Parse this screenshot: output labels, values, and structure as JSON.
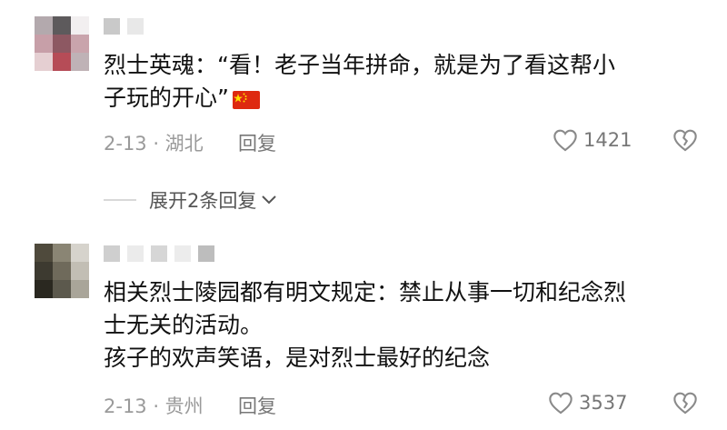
{
  "comments": [
    {
      "text_lines": [
        "烈士英魂：“看！老子当年拼命，就是为了看这帮小",
        "子玩的开心”"
      ],
      "flag_icon": "china-flag-icon",
      "date_location": "2-13 · 湖北",
      "reply_label": "回复",
      "likes": "1421"
    },
    {
      "text_lines": [
        "相关烈士陵园都有明文规定：禁止从事一切和纪念烈",
        "士无关的活动。",
        "孩子的欢声笑语，是对烈士最好的纪念"
      ],
      "date_location": "2-13 · 贵州",
      "reply_label": "回复",
      "likes": "3537"
    }
  ],
  "expand_replies_label": "展开2条回复",
  "icons": {
    "like": "heart-icon",
    "dislike": "broken-heart-icon",
    "expand": "chevron-down-icon"
  },
  "colors": {
    "text": "#111111",
    "meta": "#9a9a9a",
    "flag_red": "#de2910",
    "flag_yellow": "#ffde00"
  }
}
